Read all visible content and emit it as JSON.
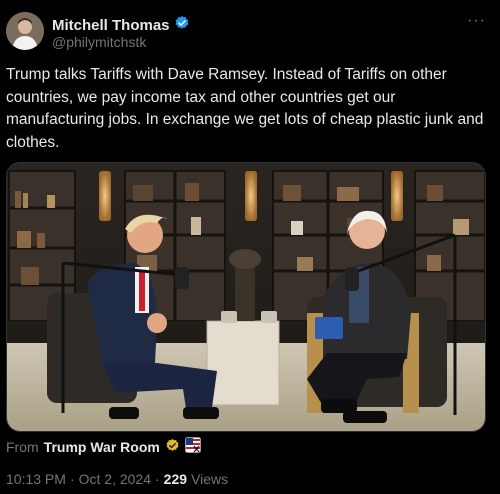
{
  "author": {
    "display_name": "Mitchell Thomas",
    "handle": "@philymitchstk",
    "verified": true,
    "verified_color": "#1d9bf0"
  },
  "more_label": "···",
  "tweet": {
    "text": "Trump talks Tariffs with Dave Ramsey. Instead of Tariffs on other countries, we pay income tax and other countries get our manufacturing jobs. In exchange we get lots of cheap plastic junk and clothes."
  },
  "source": {
    "prefix": "From",
    "name": "Trump War Room",
    "badge_color": "#e8b92e"
  },
  "meta": {
    "time": "10:13 PM",
    "separator": "·",
    "date": "Oct 2, 2024",
    "views_count": "229",
    "views_label": "Views"
  }
}
